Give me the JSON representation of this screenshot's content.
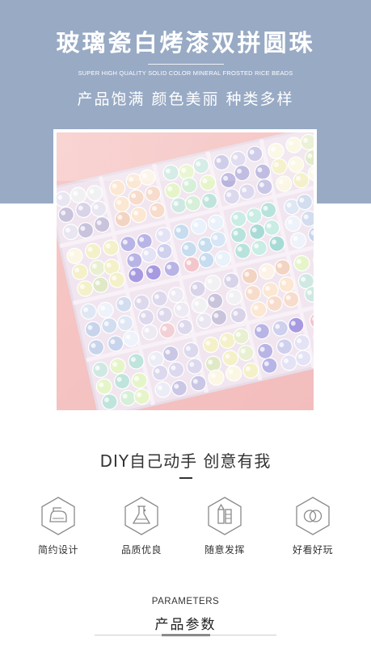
{
  "header": {
    "title": "玻璃瓷白烤漆双拼圆珠",
    "subtitle_en": "SUPER HIGH QUALITY SOLID COLOR MINERAL FROSTED RICE BEADS",
    "subtitle_cn": "产品饱满 颜色美丽 种类多样"
  },
  "photo": {
    "subject": "beads-organizer-box-photo"
  },
  "diy": {
    "title": "DIY自己动手 创意有我"
  },
  "features": [
    {
      "label": "简约设计",
      "icon": "iron-icon"
    },
    {
      "label": "品质优良",
      "icon": "flask-icon"
    },
    {
      "label": "随意发挥",
      "icon": "palette-icon"
    },
    {
      "label": "好看好玩",
      "icon": "rings-icon"
    }
  ],
  "parameters": {
    "title_en": "PARAMETERS",
    "title_cn": "产品参数"
  },
  "colors": {
    "banner": "#98aac4",
    "icon_stroke": "#8a8a8a",
    "text": "#333333"
  }
}
